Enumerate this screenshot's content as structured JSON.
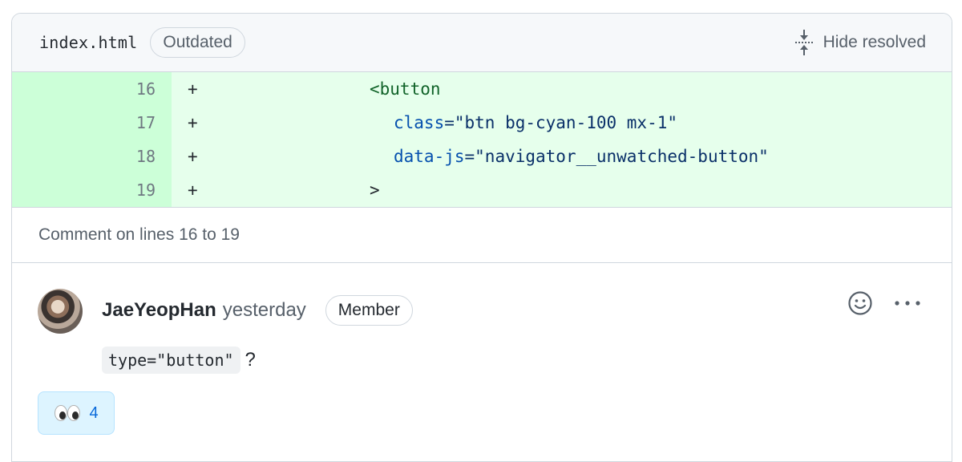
{
  "file_header": {
    "filename": "index.html",
    "outdated_label": "Outdated",
    "hide_resolved_label": "Hide resolved"
  },
  "diff": {
    "lines": [
      {
        "number": "16",
        "marker": "+",
        "indent": "        ",
        "parts": [
          {
            "t": "tag",
            "v": "<button"
          }
        ]
      },
      {
        "number": "17",
        "marker": "+",
        "indent": "          ",
        "parts": [
          {
            "t": "attr",
            "v": "class"
          },
          {
            "t": "str",
            "v": "=\"btn bg-cyan-100 mx-1\""
          }
        ]
      },
      {
        "number": "18",
        "marker": "+",
        "indent": "          ",
        "parts": [
          {
            "t": "attr",
            "v": "data-js"
          },
          {
            "t": "str",
            "v": "=\"navigator__unwatched-button\""
          }
        ]
      },
      {
        "number": "19",
        "marker": "+",
        "indent": "        ",
        "parts": [
          {
            "t": "plain",
            "v": ">"
          }
        ]
      }
    ]
  },
  "comment_on_label": "Comment on lines 16 to 19",
  "comment": {
    "author": "JaeYeopHan",
    "time": "yesterday",
    "role_badge": "Member",
    "body_code": "type=\"button\"",
    "body_suffix": "?",
    "reaction": {
      "emoji": "👀",
      "count": "4"
    }
  },
  "colors": {
    "added_bg": "#e6ffec",
    "added_gutter_bg": "#ccffd8",
    "tag": "#116329",
    "attr": "#0550ae",
    "string": "#0a3069",
    "link": "#0969da"
  },
  "icons": {
    "hide_resolved": "fold-icon",
    "add_reaction": "smiley-icon",
    "more_options": "kebab-horizontal-icon",
    "reaction_emoji": "eyes-emoji"
  }
}
